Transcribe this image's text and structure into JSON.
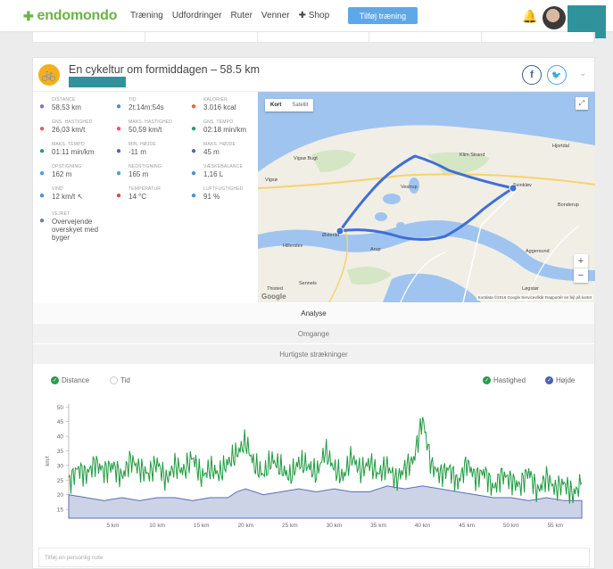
{
  "nav": {
    "logo": "endomondo",
    "links": [
      "Træning",
      "Udfordringer",
      "Ruter",
      "Venner",
      "Shop"
    ],
    "add_button": "Tilføj træning"
  },
  "workout": {
    "title": "En cykeltur om formiddagen – 58.5 km"
  },
  "stats": [
    {
      "label": "DISTANCE",
      "value": "58,53 km",
      "icon": "distance-icon",
      "color": "#8e6bbf"
    },
    {
      "label": "TID",
      "value": "2t:14m:54s",
      "icon": "clock-icon",
      "color": "#4a90d9"
    },
    {
      "label": "KALORIER",
      "value": "3.016 kcal",
      "icon": "flame-icon",
      "color": "#e8633a"
    },
    {
      "label": "GNS. HASTIGHED",
      "value": "26,03 km/t",
      "icon": "gauge-icon",
      "color": "#e85a5a"
    },
    {
      "label": "MAKS. HASTIGHED",
      "value": "50,59 km/t",
      "icon": "gauge-icon",
      "color": "#e85a5a"
    },
    {
      "label": "GNS. TEMPO",
      "value": "02:18 min/km",
      "icon": "gauge-icon",
      "color": "#2a9a6a"
    },
    {
      "label": "MAKS. TEMPO",
      "value": "01:11 min/km",
      "icon": "gauge-icon",
      "color": "#2a9a6a"
    },
    {
      "label": "MIN. HØJDE",
      "value": "-11 m",
      "icon": "mountain-icon",
      "color": "#5566aa"
    },
    {
      "label": "MAKS. HØJDE",
      "value": "45 m",
      "icon": "mountain-icon",
      "color": "#5566aa"
    },
    {
      "label": "OPSTIGNING",
      "value": "162 m",
      "icon": "ascent-icon",
      "color": "#4aa0d0"
    },
    {
      "label": "NEDSTIGNING",
      "value": "165 m",
      "icon": "descent-icon",
      "color": "#4aa0d0"
    },
    {
      "label": "VÆSKEBALANCE",
      "value": "1,16 L",
      "icon": "drop-icon",
      "color": "#4a90d9"
    },
    {
      "label": "VIND",
      "value": "12 km/t ↖",
      "icon": "wind-icon",
      "color": "#4a90d9"
    },
    {
      "label": "TEMPERATUR",
      "value": "14 °C",
      "icon": "thermometer-icon",
      "color": "#d94a4a"
    },
    {
      "label": "LUFTFUGTIGHED",
      "value": "91 %",
      "icon": "humidity-icon",
      "color": "#4a90d9"
    },
    {
      "label": "VEJRET",
      "value": "Overvejende overskyet med byger",
      "icon": "weather-icon",
      "color": "#6b7ab8"
    }
  ],
  "map": {
    "tab_map": "Kort",
    "tab_satellite": "Satellit",
    "attribution": "Kortdata ©2016 Google   Servicevilkår   Rapportér en fejl på kortet",
    "google": "Google",
    "places": [
      {
        "name": "Vigsø Bugt"
      },
      {
        "name": "Vigsø"
      },
      {
        "name": "Klim Strand"
      },
      {
        "name": "Hjortdal"
      },
      {
        "name": "Vestrup"
      },
      {
        "name": "Svinkløv"
      },
      {
        "name": "Østerild"
      },
      {
        "name": "Hillerslev"
      },
      {
        "name": "Arup"
      },
      {
        "name": "Bonderup"
      },
      {
        "name": "Aggersund"
      },
      {
        "name": "Sennels"
      },
      {
        "name": "Løgstør"
      },
      {
        "name": "Thisted"
      }
    ]
  },
  "sections": {
    "analysis": "Analyse",
    "laps": "Omgange",
    "fastest": "Hurtigste strækninger"
  },
  "chart_legend": {
    "distance": "Distance",
    "time": "Tid",
    "speed": "Hastighed",
    "elevation": "Højde"
  },
  "note_placeholder": "Tilføj en personlig note",
  "colors": {
    "brand_green": "#6bb344",
    "teal": "#30939b",
    "speed": "#2a9a4a",
    "elevation": "#4a5fb0"
  },
  "chart_data": {
    "type": "line",
    "x_unit": "km",
    "y_unit": "km/t",
    "ylabel": "km/t",
    "x_ticks": [
      "5 km",
      "10 km",
      "15 km",
      "20 km",
      "25 km",
      "30 km",
      "35 km",
      "40 km",
      "45 km",
      "50 km",
      "55 km"
    ],
    "y_ticks": [
      15,
      20,
      25,
      30,
      35,
      40,
      45,
      50
    ],
    "ylim": [
      12,
      51
    ],
    "xlim": [
      0,
      58.5
    ],
    "series": [
      {
        "name": "Hastighed",
        "x": [
          0,
          1,
          2,
          3,
          4,
          5,
          6,
          7,
          8,
          9,
          10,
          11,
          12,
          13,
          14,
          15,
          16,
          17,
          18,
          19,
          20,
          21,
          22,
          23,
          24,
          25,
          26,
          27,
          28,
          29,
          30,
          31,
          32,
          33,
          34,
          35,
          36,
          37,
          38,
          39,
          40,
          41,
          42,
          43,
          44,
          45,
          46,
          47,
          48,
          49,
          50,
          51,
          52,
          53,
          54,
          55,
          56,
          57,
          58
        ],
        "values": [
          24,
          29,
          27,
          31,
          28,
          30,
          26,
          32,
          29,
          27,
          31,
          25,
          30,
          28,
          33,
          26,
          29,
          27,
          31,
          34,
          38,
          30,
          27,
          32,
          29,
          26,
          31,
          30,
          27,
          35,
          29,
          26,
          33,
          28,
          31,
          27,
          30,
          25,
          29,
          32,
          46,
          30,
          27,
          29,
          24,
          31,
          26,
          28,
          22,
          27,
          25,
          23,
          28,
          21,
          26,
          22,
          24,
          20,
          24
        ]
      },
      {
        "name": "Højde",
        "x": [
          0,
          2,
          4,
          6,
          8,
          10,
          12,
          14,
          16,
          18,
          19,
          20,
          22,
          24,
          26,
          28,
          30,
          32,
          34,
          36,
          38,
          40,
          42,
          44,
          46,
          48,
          50,
          52,
          54,
          56,
          58
        ],
        "values": [
          20,
          19,
          18,
          19,
          18,
          19,
          19,
          18,
          19,
          19,
          21,
          22,
          20,
          21,
          22,
          21,
          22,
          21,
          21,
          23,
          22,
          23,
          22,
          21,
          20,
          19,
          19,
          18,
          19,
          18,
          18
        ]
      }
    ]
  }
}
